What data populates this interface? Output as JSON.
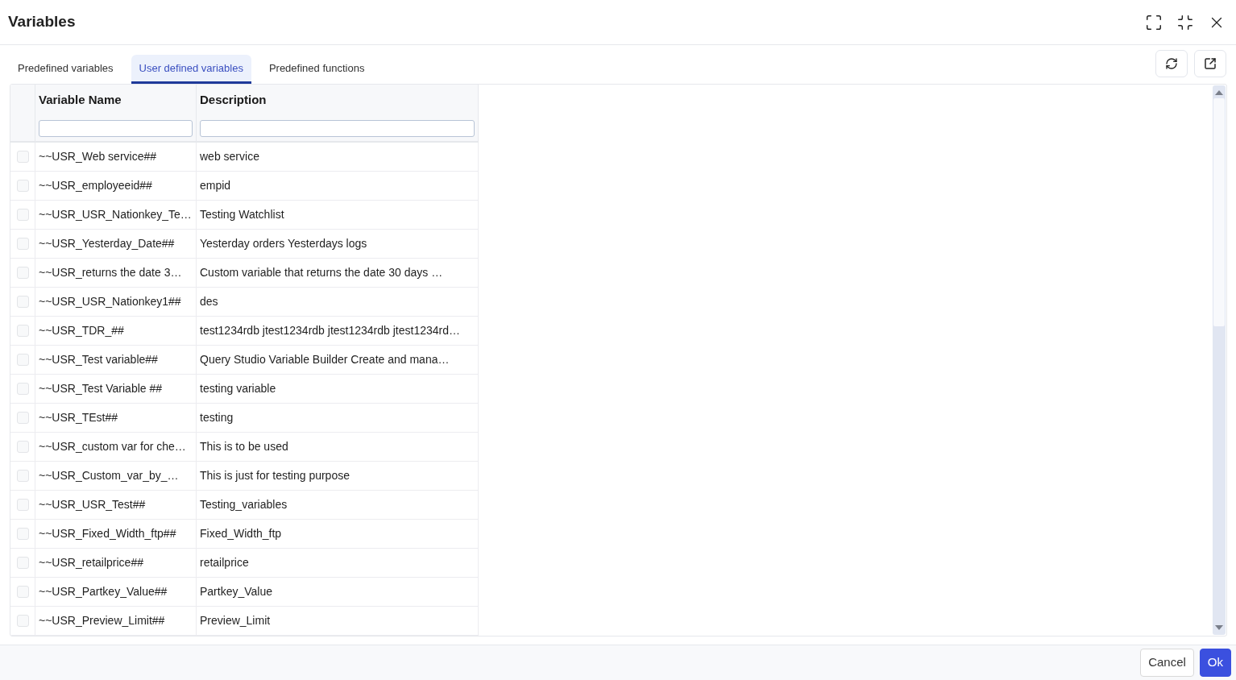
{
  "window": {
    "title": "Variables"
  },
  "tabs": [
    {
      "label": "Predefined variables",
      "selected": false
    },
    {
      "label": "User defined variables",
      "selected": true
    },
    {
      "label": "Predefined functions",
      "selected": false
    }
  ],
  "table": {
    "columns": [
      {
        "label": "Variable Name"
      },
      {
        "label": "Description"
      }
    ],
    "rows": [
      {
        "checked": false,
        "cells": [
          "~~USR_Web service##",
          "web service"
        ]
      },
      {
        "checked": false,
        "cells": [
          "~~USR_employeeid##",
          "empid"
        ]
      },
      {
        "checked": false,
        "cells": [
          "~~USR_USR_Nationkey_Te…",
          "Testing Watchlist"
        ]
      },
      {
        "checked": false,
        "cells": [
          "~~USR_Yesterday_Date##",
          "Yesterday orders Yesterdays logs"
        ]
      },
      {
        "checked": false,
        "cells": [
          "~~USR_returns the date 3…",
          "Custom variable that returns the date 30 days …"
        ]
      },
      {
        "checked": false,
        "cells": [
          "~~USR_USR_Nationkey1##",
          "des"
        ]
      },
      {
        "checked": false,
        "cells": [
          "~~USR_TDR_##",
          "test1234rdb jtest1234rdb jtest1234rdb jtest1234rd…"
        ]
      },
      {
        "checked": false,
        "cells": [
          "~~USR_Test variable##",
          "Query Studio Variable Builder Create and mana…"
        ]
      },
      {
        "checked": false,
        "cells": [
          "~~USR_Test Variable ##",
          "testing variable"
        ]
      },
      {
        "checked": false,
        "cells": [
          "~~USR_TEst##",
          "testing"
        ]
      },
      {
        "checked": false,
        "cells": [
          "~~USR_custom var for che…",
          "This is to be used"
        ]
      },
      {
        "checked": false,
        "cells": [
          "~~USR_Custom_var_by_…",
          "This is just for testing purpose"
        ]
      },
      {
        "checked": false,
        "cells": [
          "~~USR_USR_Test##",
          "Testing_variables"
        ]
      },
      {
        "checked": false,
        "cells": [
          "~~USR_Fixed_Width_ftp##",
          "Fixed_Width_ftp"
        ]
      },
      {
        "checked": false,
        "cells": [
          "~~USR_retailprice##",
          "retailprice"
        ]
      },
      {
        "checked": false,
        "cells": [
          "~~USR_Partkey_Value##",
          "Partkey_Value"
        ]
      },
      {
        "checked": false,
        "cells": [
          "~~USR_Preview_Limit##",
          "Preview_Limit"
        ]
      }
    ]
  },
  "footer": {
    "buttons": [
      {
        "label": "Cancel",
        "kind": "secondary"
      },
      {
        "label": "Ok",
        "kind": "primary"
      }
    ]
  }
}
